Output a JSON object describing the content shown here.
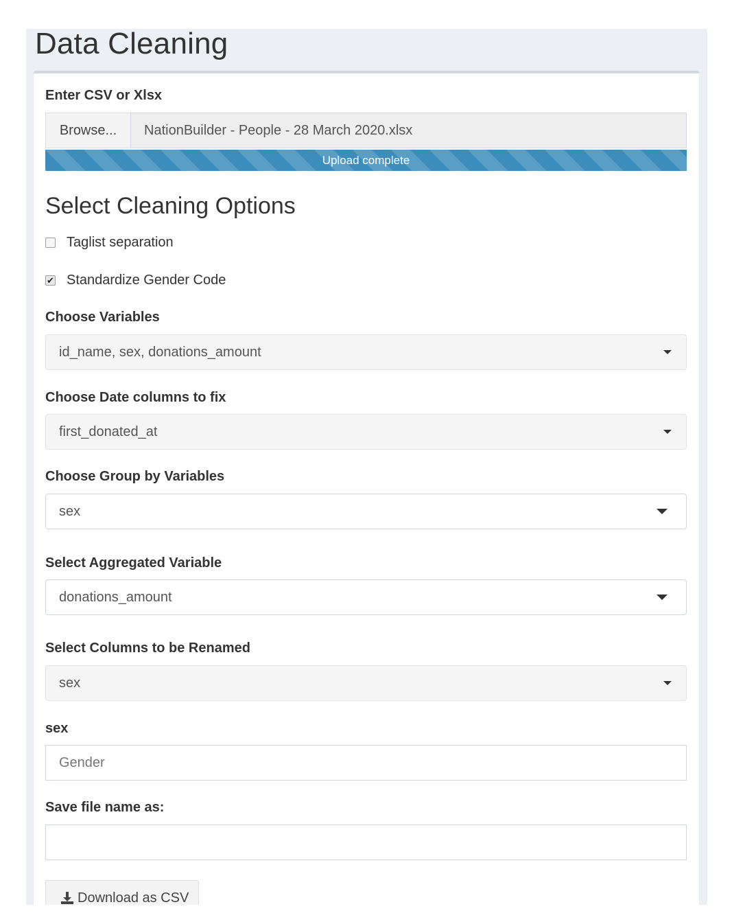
{
  "page": {
    "title": "Data Cleaning"
  },
  "upload": {
    "label": "Enter CSV or Xlsx",
    "browse_label": "Browse...",
    "file_name": "NationBuilder - People - 28 March 2020.xlsx",
    "progress_text": "Upload complete",
    "progress_value": 1.0
  },
  "options": {
    "title": "Select Cleaning Options",
    "taglist": {
      "label": "Taglist separation",
      "checked": false
    },
    "gender": {
      "label": "Standardize Gender Code",
      "checked": true
    }
  },
  "variables": {
    "label": "Choose Variables",
    "value": "id_name, sex, donations_amount"
  },
  "date_columns": {
    "label": "Choose Date columns to fix",
    "value": "first_donated_at"
  },
  "group_by": {
    "label": "Choose Group by Variables",
    "value": "sex"
  },
  "aggregate": {
    "label": "Select Aggregated Variable",
    "value": "donations_amount"
  },
  "rename": {
    "label": "Select Columns to be Renamed",
    "value": "sex"
  },
  "rename_field": {
    "label": "sex",
    "placeholder": "Gender"
  },
  "save_name": {
    "label": "Save file name as:",
    "value": ""
  },
  "download": {
    "label": "Download as CSV",
    "icon": "download-icon"
  },
  "colors": {
    "accent": "#3c8dbc",
    "background": "#ecf0f5"
  }
}
